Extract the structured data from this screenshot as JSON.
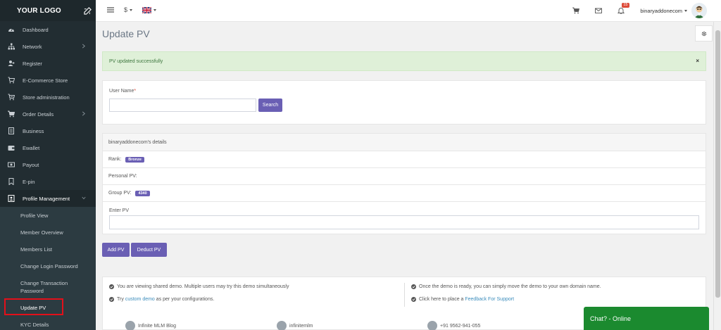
{
  "logo": {
    "text": "YOUR LOGO"
  },
  "sidebar": {
    "items": [
      {
        "label": "Dashboard",
        "icon": "dashboard-icon"
      },
      {
        "label": "Network",
        "icon": "sitemap-icon",
        "has_children": true
      },
      {
        "label": "Register",
        "icon": "user-plus-icon"
      },
      {
        "label": "E-Commerce Store",
        "icon": "cart-icon"
      },
      {
        "label": "Store administration",
        "icon": "cart-plus-icon"
      },
      {
        "label": "Order Details",
        "icon": "cart-icon",
        "has_children": true
      },
      {
        "label": "Business",
        "icon": "document-icon"
      },
      {
        "label": "Ewallet",
        "icon": "wallet-icon"
      },
      {
        "label": "Payout",
        "icon": "money-icon"
      },
      {
        "label": "E-pin",
        "icon": "bookmark-icon"
      },
      {
        "label": "Profile Management",
        "icon": "id-card-icon",
        "expanded": true
      }
    ],
    "sub_items": [
      {
        "label": "Profile View"
      },
      {
        "label": "Member Overview"
      },
      {
        "label": "Members List"
      },
      {
        "label": "Change Login Password"
      },
      {
        "label": "Change Transaction Password"
      },
      {
        "label": "Update PV"
      },
      {
        "label": "KYC Details"
      }
    ]
  },
  "topbar": {
    "currency": "$",
    "username": "binaryaddonecom",
    "notification_count": "15"
  },
  "page": {
    "title": "Update PV",
    "alert": "PV updated successfully",
    "alert_close": "×"
  },
  "search_form": {
    "label": "User Name",
    "required_mark": "*",
    "value": "",
    "button": "Search"
  },
  "details": {
    "heading": "binaryaddonecom's details",
    "rank_label": "Rank:",
    "rank_value": "Bronze",
    "personal_pv_label": "Personal PV:",
    "group_pv_label": "Group PV:",
    "group_pv_value": "4340",
    "enter_pv_label": "Enter PV",
    "enter_pv_value": ""
  },
  "actions": {
    "add": "Add PV",
    "deduct": "Deduct PV"
  },
  "footer": {
    "line1": "You are viewing shared demo. Multiple users may try this demo simultaneously",
    "line2_pre": "Try ",
    "line2_link": "custom demo",
    "line2_post": " as per your configurations.",
    "line3": "Once the demo is ready, you can simply move the demo to your own domain name.",
    "line4_pre": "Click here to place a ",
    "line4_link": "Feedback For Support",
    "bottom": [
      "Infinite MLM Blog",
      "infinitemlm",
      "+91 9562-941-055"
    ]
  },
  "chat": {
    "label": "Chat? - Online"
  },
  "colors": {
    "sidebar": "#222d32",
    "accent": "#6a5fb4",
    "alert_bg": "#dff0d8",
    "chat": "#1b8a2f",
    "highlight": "#e3101a"
  }
}
